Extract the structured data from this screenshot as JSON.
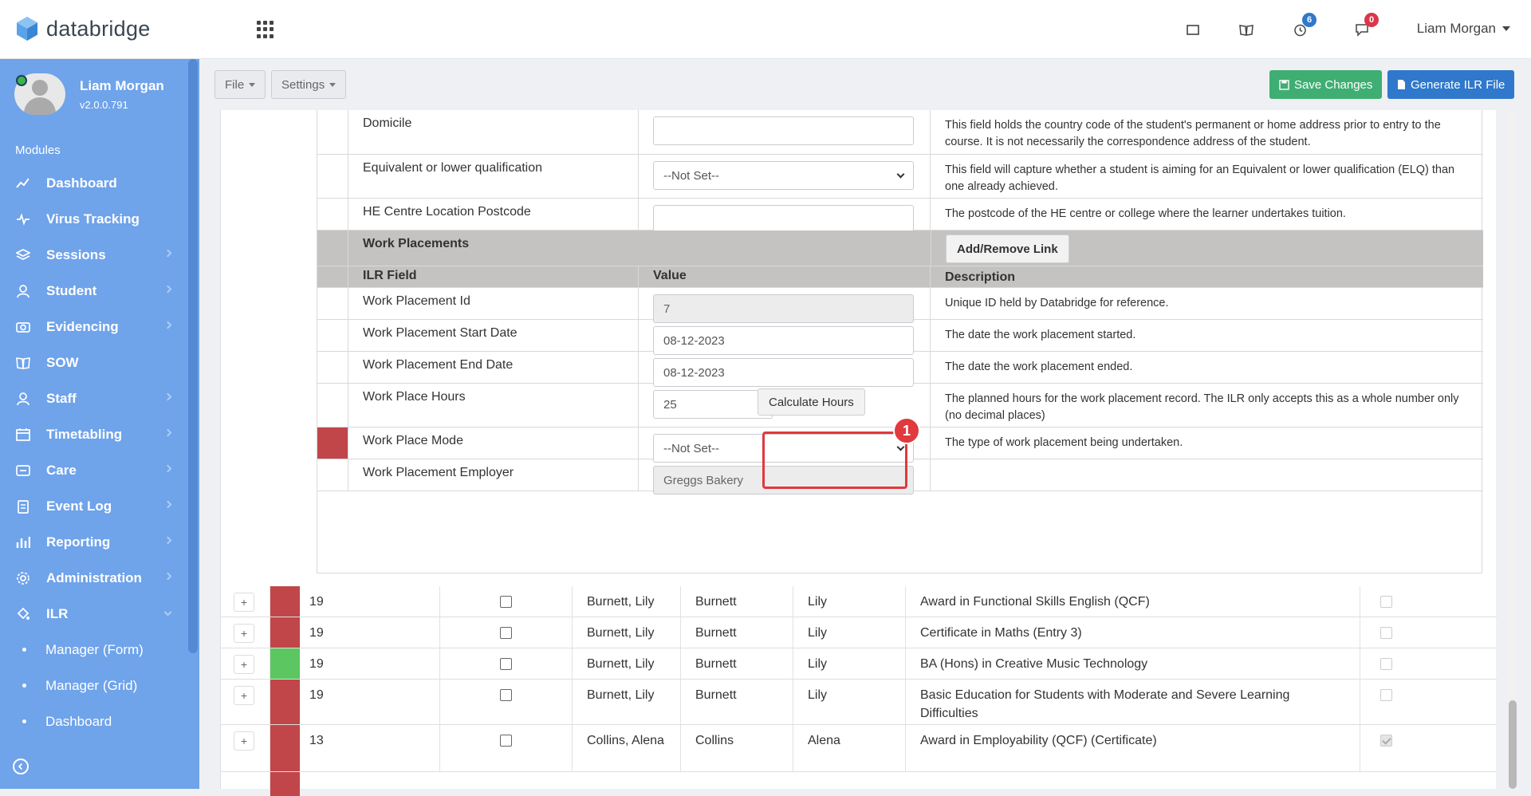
{
  "app": {
    "brand": "databridge"
  },
  "topbar": {
    "timer_badge": "6",
    "messages_badge": "0",
    "user_name": "Liam Morgan"
  },
  "sidebar": {
    "user_name": "Liam Morgan",
    "version": "v2.0.0.791",
    "modules_label": "Modules",
    "items": [
      {
        "label": "Dashboard",
        "icon": "chart-line-icon",
        "has_children": false
      },
      {
        "label": "Virus Tracking",
        "icon": "pulse-icon",
        "has_children": false
      },
      {
        "label": "Sessions",
        "icon": "layers-icon",
        "has_children": true
      },
      {
        "label": "Student",
        "icon": "user-icon",
        "has_children": true
      },
      {
        "label": "Evidencing",
        "icon": "camera-icon",
        "has_children": true
      },
      {
        "label": "SOW",
        "icon": "book-icon",
        "has_children": false
      },
      {
        "label": "Staff",
        "icon": "user-icon",
        "has_children": true
      },
      {
        "label": "Timetabling",
        "icon": "calendar-icon",
        "has_children": true
      },
      {
        "label": "Care",
        "icon": "id-card-icon",
        "has_children": true
      },
      {
        "label": "Event Log",
        "icon": "clipboard-icon",
        "has_children": true
      },
      {
        "label": "Reporting",
        "icon": "bar-chart-icon",
        "has_children": true
      },
      {
        "label": "Administration",
        "icon": "gear-icon",
        "has_children": true
      },
      {
        "label": "ILR",
        "icon": "paint-bucket-icon",
        "has_children": true,
        "expanded": true
      }
    ],
    "sub_items": [
      "Manager (Form)",
      "Manager (Grid)",
      "Dashboard"
    ]
  },
  "toolbar": {
    "file_label": "File",
    "settings_label": "Settings",
    "save_label": "Save Changes",
    "generate_label": "Generate ILR File"
  },
  "form": {
    "rows_top": [
      {
        "field": "Domicile",
        "value": "",
        "type": "text",
        "description": "This field holds the country code of the student's permanent or home address prior to entry to the course. It is not necessarily the correspondence address of the student."
      },
      {
        "field": "Equivalent or lower qualification",
        "value": "--Not Set--",
        "type": "select",
        "description": "This field will capture whether a student is aiming for an Equivalent or lower qualification (ELQ) than one already achieved."
      },
      {
        "field": "HE Centre Location Postcode",
        "value": "",
        "type": "text",
        "description": "The postcode of the HE centre or college where the learner undertakes tuition."
      }
    ],
    "section_title": "Work Placements",
    "add_remove_label": "Add/Remove Link",
    "headers": {
      "field": "ILR Field",
      "value": "Value",
      "description": "Description"
    },
    "rows_wp": [
      {
        "field": "Work Placement Id",
        "value": "7",
        "type": "readonly",
        "description": "Unique ID held by Databridge for reference."
      },
      {
        "field": "Work Placement Start Date",
        "value": "08-12-2023",
        "type": "text",
        "description": "The date the work placement started."
      },
      {
        "field": "Work Placement End Date",
        "value": "08-12-2023",
        "type": "text",
        "description": "The date the work placement ended."
      },
      {
        "field": "Work Place Hours",
        "value": "25",
        "type": "text",
        "description": "The planned hours for the work placement record. The ILR only accepts this as a whole number only (no decimal places)"
      },
      {
        "field": "Work Place Mode",
        "value": "--Not Set--",
        "type": "select",
        "description": "The type of work placement being undertaken."
      },
      {
        "field": "Work Placement Employer",
        "value": "Greggs Bakery",
        "type": "readonly",
        "description": ""
      }
    ],
    "calculate_label": "Calculate Hours",
    "annotation_number": "1"
  },
  "grid": {
    "rows": [
      {
        "age": "19",
        "full_name": "Burnett, Lily",
        "surname": "Burnett",
        "forename": "Lily",
        "course": "Award in Functional Skills English (QCF)",
        "status_color": "#c0464a",
        "flag": "light"
      },
      {
        "age": "19",
        "full_name": "Burnett, Lily",
        "surname": "Burnett",
        "forename": "Lily",
        "course": "Certificate in Maths (Entry 3)",
        "status_color": "#c0464a",
        "flag": "light"
      },
      {
        "age": "19",
        "full_name": "Burnett, Lily",
        "surname": "Burnett",
        "forename": "Lily",
        "course": "BA (Hons) in Creative Music Technology",
        "status_color": "#5cc660",
        "flag": "light"
      },
      {
        "age": "19",
        "full_name": "Burnett, Lily",
        "surname": "Burnett",
        "forename": "Lily",
        "course": "Basic Education for Students with Moderate and Severe Learning Difficulties",
        "status_color": "#c0464a",
        "flag": "light"
      },
      {
        "age": "13",
        "full_name": "Collins, Alena",
        "surname": "Collins",
        "forename": "Alena",
        "course": "Award in Employability (QCF) (Certificate)",
        "status_color": "#c0464a",
        "flag": "checked"
      }
    ]
  },
  "colors": {
    "sidebar": "#6fa3ea",
    "save": "#3fae73",
    "generate": "#2f78cc",
    "status_red": "#c0464a",
    "status_green": "#5cc660",
    "highlight": "#e0393e"
  }
}
